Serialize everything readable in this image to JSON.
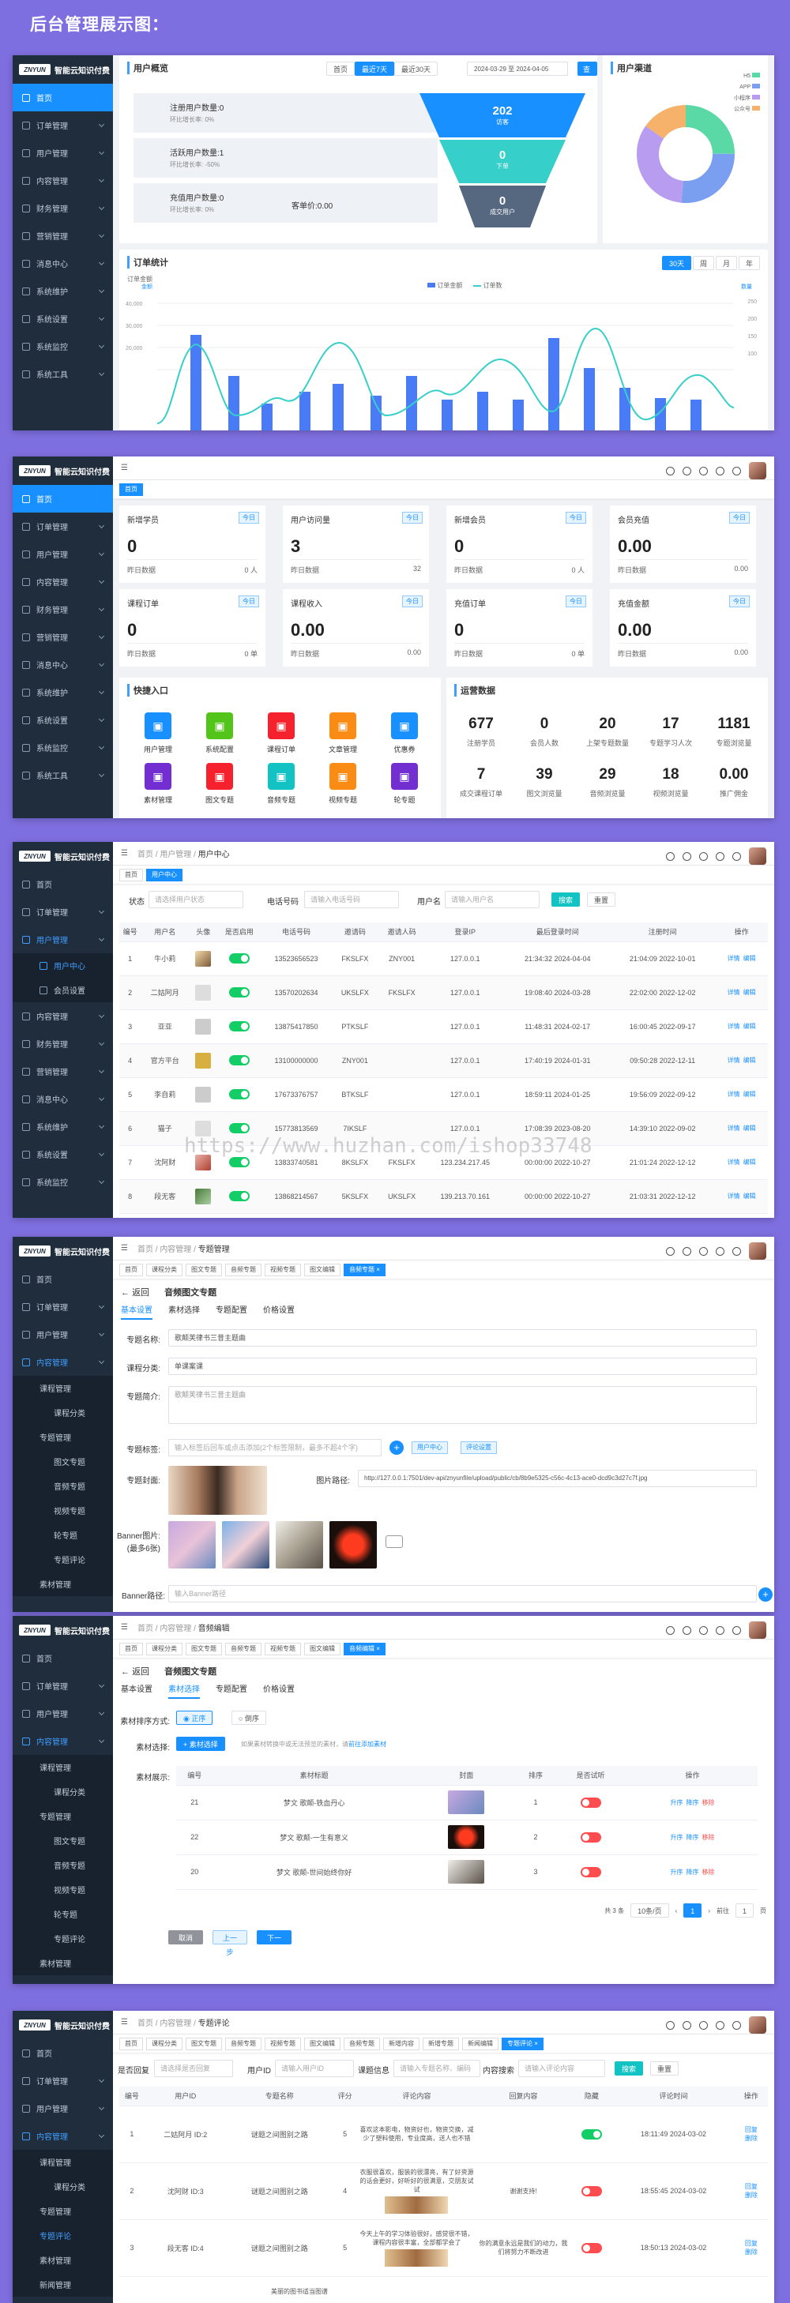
{
  "heading": "后台管理展示图：",
  "brand": {
    "logo": "ZNYUN",
    "name": "智能云知识付费"
  },
  "menu1": [
    "首页",
    "订单管理",
    "用户管理",
    "内容管理",
    "财务管理",
    "营销管理",
    "消息中心",
    "系统维护",
    "系统设置",
    "系统监控",
    "系统工具"
  ],
  "s1": {
    "overview_title": "用户概览",
    "range_tabs": [
      "首页",
      "最近7天",
      "最近30天"
    ],
    "date_range": "2024-03-29 至 2024-04-05",
    "search": "查询",
    "stats": [
      {
        "title": "注册用户数量:0",
        "sub": "环比增长率: 0%"
      },
      {
        "title": "活跃用户数量:1",
        "sub": "环比增长率: -50%"
      },
      {
        "title": "充值用户数量:0",
        "sub": "环比增长率: 0%",
        "extra": "客单价:0.00"
      }
    ],
    "funnel": [
      {
        "value": "202",
        "label": "访客"
      },
      {
        "value": "0",
        "label": "下单"
      },
      {
        "value": "0",
        "label": "成交用户"
      }
    ],
    "channel_title": "用户渠道",
    "channel_legend": [
      "H5",
      "APP",
      "小程序",
      "公众号"
    ],
    "channel_colors": [
      "#5ad8a6",
      "#7b9ff0",
      "#b79cf0",
      "#f6b26b"
    ],
    "order_title": "订单统计",
    "order_tabs": [
      "30天",
      "周",
      "月",
      "年"
    ],
    "order_legend": [
      "订单金额",
      "订单数"
    ],
    "y_left_title": "订单金额",
    "y_left_name": "金额",
    "y_right_name": "数量",
    "y_left_ticks": [
      "40,000",
      "30,000",
      "20,000"
    ],
    "y_right_ticks": [
      "250",
      "200",
      "150",
      "100"
    ]
  },
  "s2": {
    "cards": [
      {
        "label": "新增学员",
        "badge": "今日",
        "value": "0",
        "foot_l": "昨日数据",
        "foot_r": "0 人"
      },
      {
        "label": "用户访问量",
        "badge": "今日",
        "value": "3",
        "foot_l": "昨日数据",
        "foot_r": "32"
      },
      {
        "label": "新增会员",
        "badge": "今日",
        "value": "0",
        "foot_l": "昨日数据",
        "foot_r": "0 人"
      },
      {
        "label": "会员充值",
        "badge": "今日",
        "value": "0.00",
        "foot_l": "昨日数据",
        "foot_r": "0.00"
      },
      {
        "label": "课程订单",
        "badge": "今日",
        "value": "0",
        "foot_l": "昨日数据",
        "foot_r": "0 单"
      },
      {
        "label": "课程收入",
        "badge": "今日",
        "value": "0.00",
        "foot_l": "昨日数据",
        "foot_r": "0.00"
      },
      {
        "label": "充值订单",
        "badge": "今日",
        "value": "0",
        "foot_l": "昨日数据",
        "foot_r": "0 单"
      },
      {
        "label": "充值金额",
        "badge": "今日",
        "value": "0.00",
        "foot_l": "昨日数据",
        "foot_r": "0.00"
      }
    ],
    "quick_title": "快捷入口",
    "quick": [
      {
        "label": "用户管理",
        "color": "#1890ff"
      },
      {
        "label": "系统配置",
        "color": "#52c41a"
      },
      {
        "label": "课程订单",
        "color": "#f5222d"
      },
      {
        "label": "文章管理",
        "color": "#fa8c16"
      },
      {
        "label": "优惠券",
        "color": "#1890ff"
      },
      {
        "label": "素材管理",
        "color": "#722ed1"
      },
      {
        "label": "图文专题",
        "color": "#f5222d"
      },
      {
        "label": "音频专题",
        "color": "#13c2c2"
      },
      {
        "label": "视频专题",
        "color": "#fa8c16"
      },
      {
        "label": "轮专题",
        "color": "#722ed1"
      }
    ],
    "ops_title": "运营数据",
    "ops": [
      {
        "n": "677",
        "l": "注册学员"
      },
      {
        "n": "0",
        "l": "会员人数"
      },
      {
        "n": "20",
        "l": "上架专题数量"
      },
      {
        "n": "17",
        "l": "专题学习人次"
      },
      {
        "n": "1181",
        "l": "专题浏览量"
      },
      {
        "n": "7",
        "l": "成交课程订单"
      },
      {
        "n": "39",
        "l": "图文浏览量"
      },
      {
        "n": "29",
        "l": "音频浏览量"
      },
      {
        "n": "18",
        "l": "视频浏览量"
      },
      {
        "n": "0.00",
        "l": "推广佣金"
      }
    ]
  },
  "s3": {
    "crumbs": [
      "首页",
      "用户管理",
      "用户中心"
    ],
    "tags": [
      "首页",
      "用户中心"
    ],
    "sub_menu": [
      "用户中心",
      "会员设置"
    ],
    "filters": [
      {
        "label": "状态",
        "placeholder": "请选择用户状态"
      },
      {
        "label": "电话号码",
        "placeholder": "请输入电话号码"
      },
      {
        "label": "用户名",
        "placeholder": "请输入用户名"
      }
    ],
    "search": "搜索",
    "reset": "重置",
    "columns": [
      "编号",
      "用户名",
      "头像",
      "是否启用",
      "电话号码",
      "邀请码",
      "邀请人码",
      "登录IP",
      "最后登录时间",
      "注册时间",
      "操作"
    ],
    "rows": [
      [
        "1",
        "牛小莉",
        "",
        "13523656523",
        "FKSLFX",
        "ZNY001",
        "127.0.0.1",
        "21:34:32 2024-04-04",
        "21:04:09 2022-10-01"
      ],
      [
        "2",
        "二姑阿月",
        "",
        "13570202634",
        "UKSLFX",
        "FKSLFX",
        "127.0.0.1",
        "19:08:40 2024-03-28",
        "22:02:00 2022-12-02"
      ],
      [
        "3",
        "亚亚",
        "",
        "13875417850",
        "PTKSLF",
        "",
        "127.0.0.1",
        "11:48:31 2024-02-17",
        "16:00:45 2022-09-17"
      ],
      [
        "4",
        "官方平台",
        "",
        "13100000000",
        "ZNY001",
        "",
        "127.0.0.1",
        "17:40:19 2024-01-31",
        "09:50:28 2022-12-11"
      ],
      [
        "5",
        "李自莉",
        "",
        "17673376757",
        "BTKSLF",
        "",
        "127.0.0.1",
        "18:59:11 2024-01-25",
        "19:56:09 2022-09-12"
      ],
      [
        "6",
        "猫子",
        "",
        "15773813569",
        "7IKSLF",
        "",
        "127.0.0.1",
        "17:08:39 2023-08-20",
        "14:39:10 2022-09-02"
      ],
      [
        "7",
        "沈阿财",
        "",
        "13833740581",
        "8KSLFX",
        "FKSLFX",
        "123.234.217.45",
        "00:00:00 2022-10-27",
        "21:01:24 2022-12-12"
      ],
      [
        "8",
        "段无客",
        "",
        "13868214567",
        "5KSLFX",
        "UKSLFX",
        "139.213.70.161",
        "00:00:00 2022-10-27",
        "21:03:31 2022-12-12"
      ]
    ],
    "actions": [
      "详情",
      "编辑"
    ],
    "watermark": "https://www.huzhan.com/ishop33748"
  },
  "s4": {
    "crumbs": [
      "首页",
      "内容管理",
      "专题管理"
    ],
    "tags": [
      "首页",
      "课程分类",
      "图文专题",
      "音频专题",
      "视频专题",
      "图文编辑",
      "音频专题 ×"
    ],
    "sub_menu": [
      "课程管理",
      "课程分类",
      "专题管理",
      "图文专题",
      "音频专题",
      "视频专题",
      "轮专题",
      "专题评论",
      "素材管理"
    ],
    "back": "返回",
    "title": "音频图文专题",
    "tabs": [
      "基本设置",
      "素材选择",
      "专题配置",
      "价格设置"
    ],
    "fields": [
      {
        "label": "专题名称:",
        "value": "歌颠芙律书三昔主题曲"
      },
      {
        "label": "课程分类:",
        "value": "单课案课"
      },
      {
        "label": "专题简介:",
        "value": "歌颠芙律书三昔主题曲"
      },
      {
        "label": "专题标签:",
        "value": "输入标签后回车或点击添加(2个标签限制，最多不超4个字)"
      },
      {
        "label": "专题封面:",
        "value": ""
      },
      {
        "label": "图片路径:",
        "value": "http://127.0.0.1:7501/dev-api/znyunfile/upload/public/cb/8b9e5325-c56c-4c13-ace0-dcd9c3d27c7f.jpg"
      }
    ],
    "tag_chips": [
      "用户中心",
      "评论设置"
    ],
    "banner_label": "Banner图片:",
    "banner_hint": "(最多6张)",
    "banner_path_label": "Banner路径:",
    "banner_path_placeholder": "输入Banner路径"
  },
  "s5": {
    "crumbs": [
      "首页",
      "内容管理",
      "音频编辑"
    ],
    "tags": [
      "首页",
      "课程分类",
      "图文专题",
      "音频专题",
      "视频专题",
      "图文编辑",
      "音频编辑 ×"
    ],
    "back": "返回",
    "title": "音频图文专题",
    "tabs": [
      "基本设置",
      "素材选择",
      "专题配置",
      "价格设置"
    ],
    "sort_label": "素材排序方式:",
    "sort_opts": [
      "正序",
      "倒序"
    ],
    "pick_label": "素材选择:",
    "pick_btn": "素材选择",
    "pick_hint": "如果素材转换中或无法预览的素材，请",
    "pick_link": "前往添加素材",
    "list_label": "素材展示:",
    "columns": [
      "编号",
      "素材标题",
      "封面",
      "排序",
      "是否试听",
      "操作"
    ],
    "rows": [
      [
        "21",
        "梦文 歌颠-铁血丹心",
        "",
        "1"
      ],
      [
        "22",
        "梦文 歌颠-一生有意义",
        "",
        "2"
      ],
      [
        "20",
        "梦文 歌颠-世间始终你好",
        "",
        "3"
      ]
    ],
    "row_actions": [
      "升序",
      "降序",
      "移除"
    ],
    "try_label": "试听",
    "total": "共 3 条",
    "page_size": "10条/页",
    "page": "1",
    "goto_label": "前往",
    "goto_val": "1",
    "goto_suffix": "页",
    "buttons": [
      "取消",
      "上一步",
      "下一步"
    ]
  },
  "s6": {
    "crumbs": [
      "首页",
      "内容管理",
      "专题评论"
    ],
    "tags": [
      "首页",
      "课程分类",
      "图文专题",
      "音频专题",
      "视频专题",
      "图文编辑",
      "音频专题",
      "新增内容",
      "新增专题",
      "新闻编辑",
      "专题评论 ×"
    ],
    "sub_menu": [
      "课程管理",
      "课程分类",
      "专题管理",
      "专题评论",
      "素材管理",
      "新闻管理"
    ],
    "filters": [
      {
        "label": "是否回复",
        "placeholder": "请选择是否回复"
      },
      {
        "label": "用户ID",
        "placeholder": "请输入用户ID"
      },
      {
        "label": "课题信息",
        "placeholder": "请输入专题名称、编码"
      },
      {
        "label": "内容搜索",
        "placeholder": "请输入评论内容"
      }
    ],
    "search": "搜索",
    "reset": "重置",
    "columns": [
      "编号",
      "用户ID",
      "专题名称",
      "评分",
      "评论内容",
      "回复内容",
      "隐藏",
      "评论时间",
      "操作"
    ],
    "rows": [
      {
        "no": "1",
        "uid": "二姑阿月 ID:2",
        "topic": "谜题之间图别之路",
        "score": "5",
        "comment": "喜欢这本影电，物资好也，物资交换，减少了塑料使用，专业度高，送人也不错",
        "reply": "",
        "time": "18:11:49 2024-03-02",
        "on": true
      },
      {
        "no": "2",
        "uid": "沈阿财 ID:3",
        "topic": "谜题之间图别之路",
        "score": "4",
        "comment": "衣服很喜欢，服装的很漂亮，有了好资源的话会更好，好听好的很满意，交朋友试试",
        "reply": "谢谢支持!",
        "time": "18:55:45 2024-03-02",
        "on": false
      },
      {
        "no": "3",
        "uid": "段无客 ID:4",
        "topic": "谜题之间图别之路",
        "score": "5",
        "comment": "今天上午的学习体验很好，感觉很不错，课程内容很丰富，全部都学会了",
        "reply": "你的满意永远是我们的动力，我们将努力不断改进",
        "time": "18:50:13 2024-03-02",
        "on": false
      }
    ],
    "row_actions": [
      "回复",
      "删除"
    ],
    "extra_row": "美丽的图书适当图谱"
  }
}
